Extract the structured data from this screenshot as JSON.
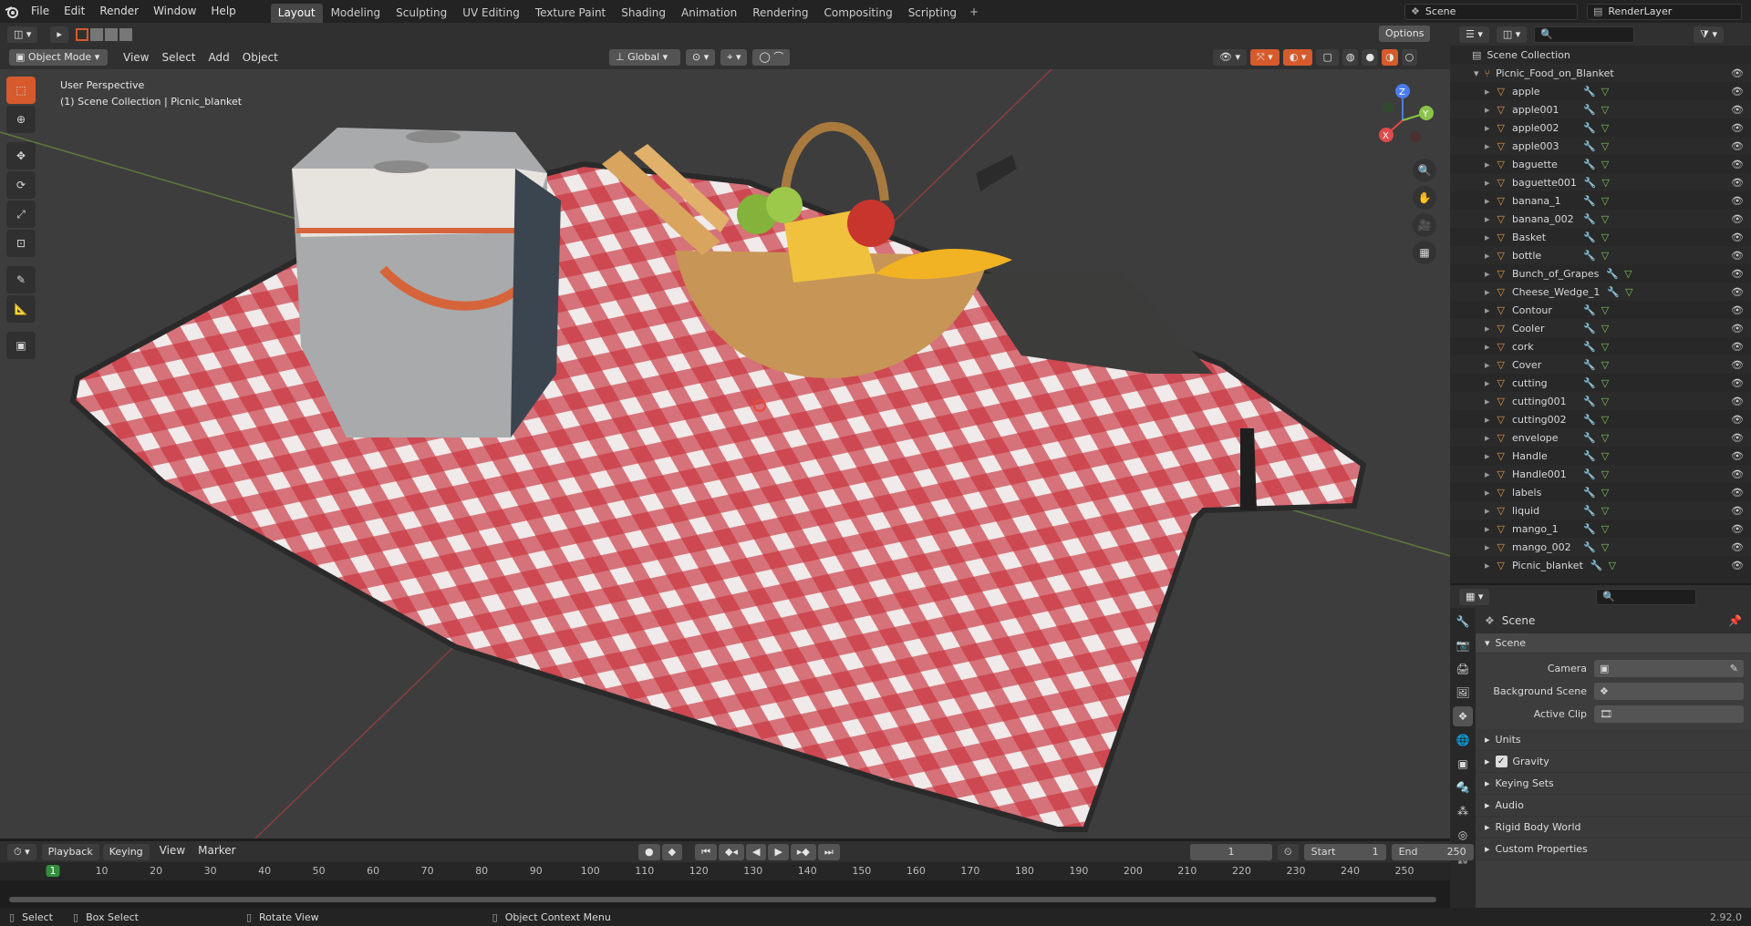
{
  "top_menu": [
    "File",
    "Edit",
    "Render",
    "Window",
    "Help"
  ],
  "workspaces": [
    "Layout",
    "Modeling",
    "Sculpting",
    "UV Editing",
    "Texture Paint",
    "Shading",
    "Animation",
    "Rendering",
    "Compositing",
    "Scripting"
  ],
  "active_workspace": "Layout",
  "scene_name": "Scene",
  "view_layer_name": "RenderLayer",
  "viewport_header": {
    "mode": "Object Mode",
    "menus": [
      "View",
      "Select",
      "Add",
      "Object"
    ],
    "orientation": "Global",
    "options_label": "Options"
  },
  "viewport_overlay": {
    "line1": "User Perspective",
    "line2": "(1) Scene Collection | Picnic_blanket"
  },
  "gizmo_axes": {
    "x": "X",
    "y": "Y",
    "z": "Z"
  },
  "outliner": {
    "scene_collection": "Scene Collection",
    "collection": "Picnic_Food_on_Blanket",
    "objects": [
      "apple",
      "apple001",
      "apple002",
      "apple003",
      "baguette",
      "baguette001",
      "banana_1",
      "banana_002",
      "Basket",
      "bottle",
      "Bunch_of_Grapes",
      "Cheese_Wedge_1",
      "Contour",
      "Cooler",
      "cork",
      "Cover",
      "cutting",
      "cutting001",
      "cutting002",
      "envelope",
      "Handle",
      "Handle001",
      "labels",
      "liquid",
      "mango_1",
      "mango_002",
      "Picnic_blanket"
    ]
  },
  "properties": {
    "context_title": "Scene",
    "panel_scene": "Scene",
    "camera_label": "Camera",
    "background_scene_label": "Background Scene",
    "active_clip_label": "Active Clip",
    "sub_panels": [
      "Units",
      "Gravity",
      "Keying Sets",
      "Audio",
      "Rigid Body World",
      "Custom Properties"
    ]
  },
  "timeline": {
    "menus": [
      "Playback",
      "Keying",
      "View",
      "Marker"
    ],
    "current_frame": "1",
    "start_label": "Start",
    "start_value": "1",
    "end_label": "End",
    "end_value": "250",
    "ruler_marks": [
      "1",
      "10",
      "20",
      "30",
      "40",
      "50",
      "60",
      "70",
      "80",
      "90",
      "100",
      "110",
      "120",
      "130",
      "140",
      "150",
      "160",
      "170",
      "180",
      "190",
      "200",
      "210",
      "220",
      "230",
      "240",
      "250"
    ]
  },
  "statusbar": {
    "select": "Select",
    "box_select": "Box Select",
    "rotate_view": "Rotate View",
    "context_menu": "Object Context Menu",
    "version": "2.92.0"
  },
  "colors": {
    "accent": "#d65a2c",
    "active_tab": "#474747",
    "x_axis": "#e04b4b",
    "y_axis": "#8bc34a",
    "z_axis": "#4a7cf0"
  }
}
